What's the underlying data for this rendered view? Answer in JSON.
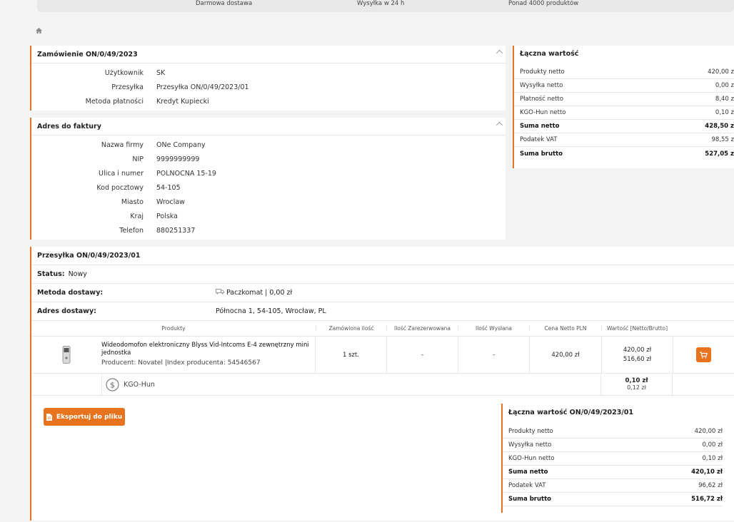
{
  "topbar": {
    "items": [
      "Darmowa dostawa",
      "Wysyłka w 24 h",
      "Ponad 4000 produktów"
    ]
  },
  "order": {
    "title": "Zamówienie ON/0/49/2023",
    "rows": [
      {
        "k": "Użytkownik",
        "v": "SK"
      },
      {
        "k": "Przesyłka",
        "v": "Przesyłka ON/0/49/2023/01"
      },
      {
        "k": "Metoda płatności",
        "v": "Kredyt Kupiecki"
      }
    ]
  },
  "invoice": {
    "title": "Adres do faktury",
    "rows": [
      {
        "k": "Nazwa firmy",
        "v": "ONe Company"
      },
      {
        "k": "NIP",
        "v": "9999999999"
      },
      {
        "k": "Ulica i numer",
        "v": "POLNOCNA 15-19"
      },
      {
        "k": "Kod pocztowy",
        "v": "54-105"
      },
      {
        "k": "Miasto",
        "v": "Wroclaw"
      },
      {
        "k": "Kraj",
        "v": "Polska"
      },
      {
        "k": "Telefon",
        "v": "880251337"
      }
    ]
  },
  "total": {
    "title": "Łączna wartość",
    "rows": [
      {
        "k": "Produkty netto",
        "v": "420,00 z"
      },
      {
        "k": "Wysyłka netto",
        "v": "0,00 z"
      },
      {
        "k": "Płatność netto",
        "v": "8,40 z"
      },
      {
        "k": "KGO-Hun netto",
        "v": "0,10 z"
      },
      {
        "k": "Suma netto",
        "v": "428,50 z",
        "bold": true
      },
      {
        "k": "Podatek VAT",
        "v": "98,55 z"
      },
      {
        "k": "Suma brutto",
        "v": "527,05 z",
        "bold": true
      }
    ]
  },
  "shipment": {
    "title": "Przesyłka ON/0/49/2023/01",
    "status_label": "Status:",
    "status_value": "Nowy",
    "method_label": "Metoda dostawy:",
    "method_value": "Paczkomat | 0,00 zł",
    "address_label": "Adres dostawy:",
    "address_value": "Północna 1, 54-105, Wrocław, PL",
    "headers": [
      "Produkty",
      "Zamówiona ilość",
      "Ilość Zarezerwowana",
      "Ilość Wysłana",
      "Cena Netto PLN",
      "Wartość [Netto/Brutto]"
    ],
    "product": {
      "name": "Wideodomofon elektroniczny Blyss Vid-Intcoms E-4 zewnętrzny mini jednostka",
      "meta": "Producent: Novatel |Index producenta: 54546567",
      "qty": "1 szt.",
      "reserved": "-",
      "shipped": "-",
      "price": "420,00 zł",
      "net": "420,00 zł",
      "gross": "516,60 zł"
    },
    "fee": {
      "name": "KGO-Hun",
      "net": "0,10 zł",
      "gross": "0,12 zł"
    }
  },
  "export_button": "Eksportuj do pliku",
  "shipment_total": {
    "title": "Łączna wartość ON/0/49/2023/01",
    "rows": [
      {
        "k": "Produkty netto",
        "v": "420,00 zł"
      },
      {
        "k": "Wysyłka netto",
        "v": "0,00 zł"
      },
      {
        "k": "KGO-Hun netto",
        "v": "0,10 zł"
      },
      {
        "k": "Suma netto",
        "v": "420,10 zł",
        "bold": true
      },
      {
        "k": "Podatek VAT",
        "v": "96,62 zł"
      },
      {
        "k": "Suma brutto",
        "v": "516,72 zł",
        "bold": true
      }
    ]
  },
  "colors": {
    "accent": "#e8731e"
  }
}
